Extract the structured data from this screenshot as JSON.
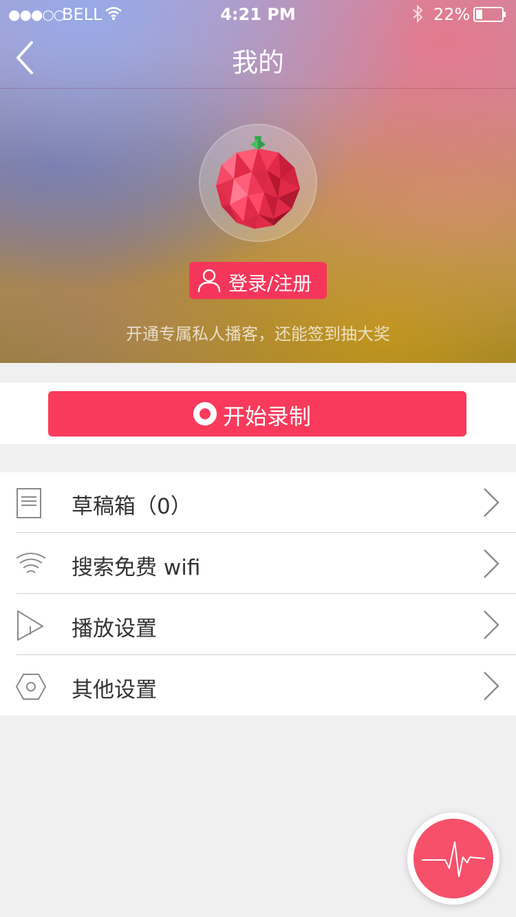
{
  "status_bar": {
    "signal": "●●●○○",
    "carrier": "BELL",
    "time": "4:21 PM",
    "battery": "22%"
  },
  "header": {
    "title": "我的"
  },
  "profile": {
    "login_label": "登录/注册",
    "tagline": "开通专属私人播客，还能签到抽大奖"
  },
  "record": {
    "label": "开始录制"
  },
  "menu": {
    "items": [
      {
        "label": "草稿箱（0）",
        "icon": "draft-icon"
      },
      {
        "label": "搜索免费 wifi",
        "icon": "wifi-icon"
      },
      {
        "label": "播放设置",
        "icon": "play-icon"
      },
      {
        "label": "其他设置",
        "icon": "settings-icon"
      }
    ]
  },
  "colors": {
    "accent": "#fa3a5c",
    "background": "#f0f0f0"
  }
}
